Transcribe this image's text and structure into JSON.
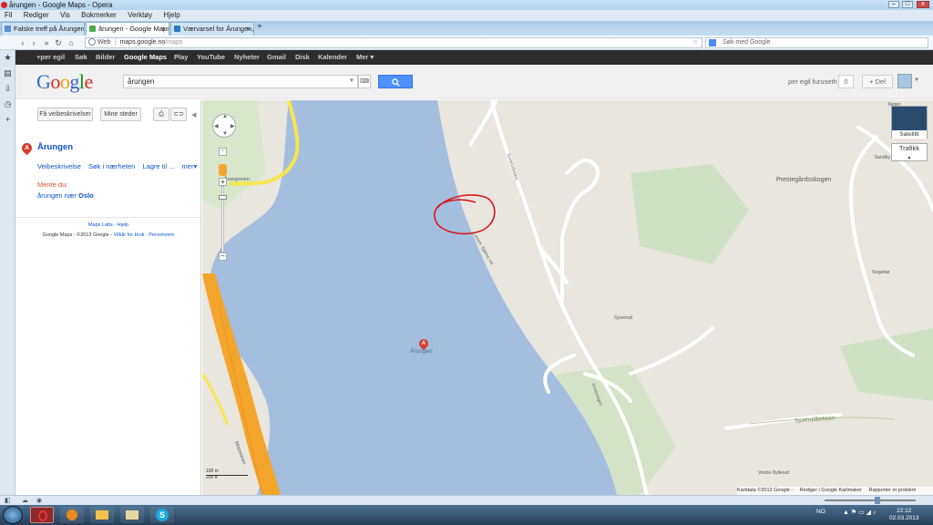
{
  "window": {
    "title": "årungen - Google Maps - Opera"
  },
  "menu": [
    "Fil",
    "Rediger",
    "Vis",
    "Bokmerker",
    "Verktøy",
    "Hjelp"
  ],
  "tabs": [
    {
      "label": "Falske treff på Årungen."
    },
    {
      "label": "årungen - Google Maps"
    },
    {
      "label": "Værvarsel for Årungen,..."
    }
  ],
  "address": {
    "prefix": "Web",
    "host": "maps.google.no",
    "path": "/maps",
    "search_placeholder": "Søk med Google"
  },
  "gbar": [
    "+per egil",
    "Søk",
    "Bilder",
    "Google Maps",
    "Play",
    "YouTube",
    "Nyheter",
    "Gmail",
    "Disk",
    "Kalender",
    "Mer ▾"
  ],
  "header": {
    "logo": [
      "G",
      "o",
      "o",
      "g",
      "l",
      "e"
    ],
    "query": "årungen",
    "user": "per egil furuseth",
    "count": "0",
    "share": "+ Del"
  },
  "panel": {
    "directions": "Få veibeskrivelser",
    "my_places": "Mine steder",
    "result_letter": "A",
    "result_title": "Årungen",
    "links": [
      "Veibeskrivelse",
      "Søk i nærheten",
      "Lagre til ...",
      "mer▾"
    ],
    "did_you_mean": "Mente du:",
    "suggest_prefix": "årungen nær",
    "suggest_place": "Oslo",
    "footer_links": "Maps Labs - Hjelp",
    "footer_copy": "Google Maps - ©2013 Google -",
    "footer_terms": "Vilkår for bruk - Personvern"
  },
  "map": {
    "satellite": "Satellitt",
    "traffic": "Trafikk",
    "marker_letter": "A",
    "lake_label": "Årungen",
    "scale_m": "100 m",
    "scale_ft": "200 ft",
    "labels": {
      "prestegard": "Prestegårdsskogen",
      "syverud": "Syverud",
      "syverudbekken": "Syverudbekken",
      "sogebø": "Sogebø",
      "sundby": "Sundby",
      "teigen": "Teigen",
      "vestre_dyllerud": "Vestre Dyllerud",
      "syverudveien": "Syverudveien",
      "larsbjornsvei": "Lensm. Bjørns vei",
      "kroervegen": "Kroervegen",
      "arungveien": "Årungveien",
      "moosmarka": "Moosveien"
    },
    "attribution": [
      "Kartdata ©2013 Google -",
      "Rediger i Google Kartmaker",
      "Rapporter et problem"
    ]
  },
  "taskbar": {
    "time": "22:12",
    "date": "02.03.2013",
    "lang": "NO"
  },
  "colors": {
    "water": "#a4bedf",
    "land": "#e9e6df",
    "forest": "#cfe1c4",
    "highway": "#f4a52b",
    "local_road": "#ffffff",
    "yellow_road": "#f7e64b",
    "annotation": "#d7191c"
  }
}
